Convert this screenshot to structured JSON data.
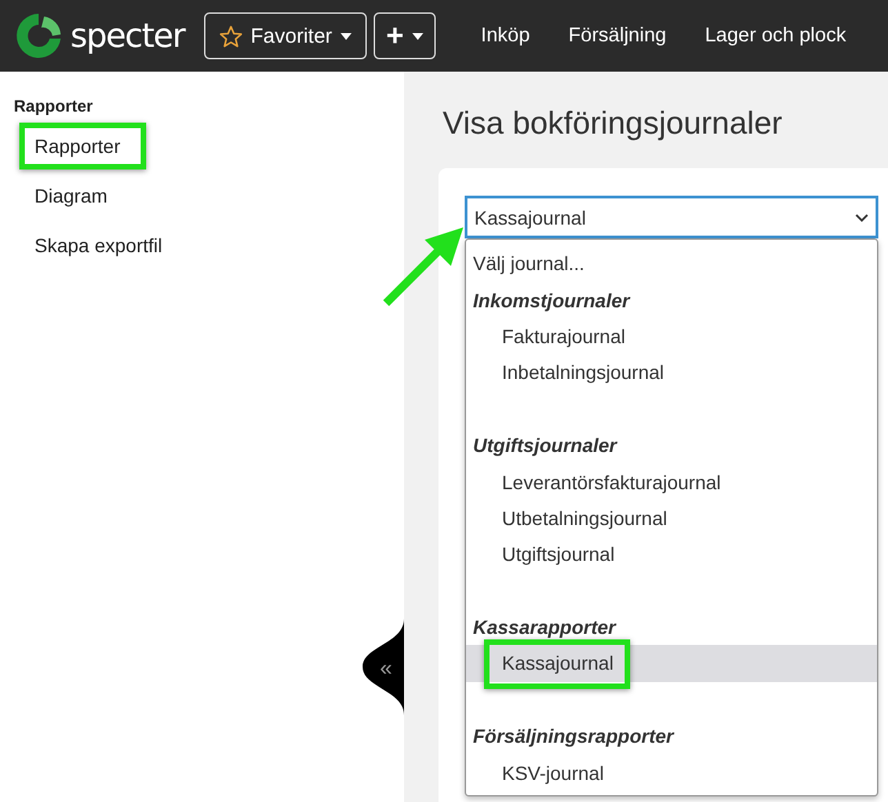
{
  "header": {
    "logo_text": "specter",
    "favorites_button": "Favoriter",
    "add_button": "+",
    "nav": [
      {
        "label": "Inköp"
      },
      {
        "label": "Försäljning"
      },
      {
        "label": "Lager och plock"
      }
    ]
  },
  "sidebar": {
    "heading": "Rapporter",
    "items": [
      {
        "label": "Rapporter",
        "highlighted": true
      },
      {
        "label": "Diagram",
        "highlighted": false
      },
      {
        "label": "Skapa exportfil",
        "highlighted": false
      }
    ]
  },
  "page": {
    "title": "Visa bokföringsjournaler",
    "collapse_handle": "«"
  },
  "journal_select": {
    "value": "Kassajournal",
    "pointer_arrow": true,
    "options": [
      {
        "kind": "option",
        "label": "Välj journal...",
        "selected": false,
        "highlighted": false
      },
      {
        "kind": "group",
        "label": "Inkomstjournaler"
      },
      {
        "kind": "option",
        "label": "Fakturajournal",
        "selected": false,
        "highlighted": false
      },
      {
        "kind": "option",
        "label": "Inbetalningsjournal",
        "selected": false,
        "highlighted": false
      },
      {
        "kind": "spacer"
      },
      {
        "kind": "group",
        "label": "Utgiftsjournaler"
      },
      {
        "kind": "option",
        "label": "Leverantörsfakturajournal",
        "selected": false,
        "highlighted": false
      },
      {
        "kind": "option",
        "label": "Utbetalningsjournal",
        "selected": false,
        "highlighted": false
      },
      {
        "kind": "option",
        "label": "Utgiftsjournal",
        "selected": false,
        "highlighted": false
      },
      {
        "kind": "spacer"
      },
      {
        "kind": "group",
        "label": "Kassarapporter"
      },
      {
        "kind": "option",
        "label": "Kassajournal",
        "selected": true,
        "highlighted": true
      },
      {
        "kind": "spacer"
      },
      {
        "kind": "group",
        "label": "Försäljningsrapporter"
      },
      {
        "kind": "option",
        "label": "KSV-journal",
        "selected": false,
        "highlighted": false
      }
    ]
  }
}
